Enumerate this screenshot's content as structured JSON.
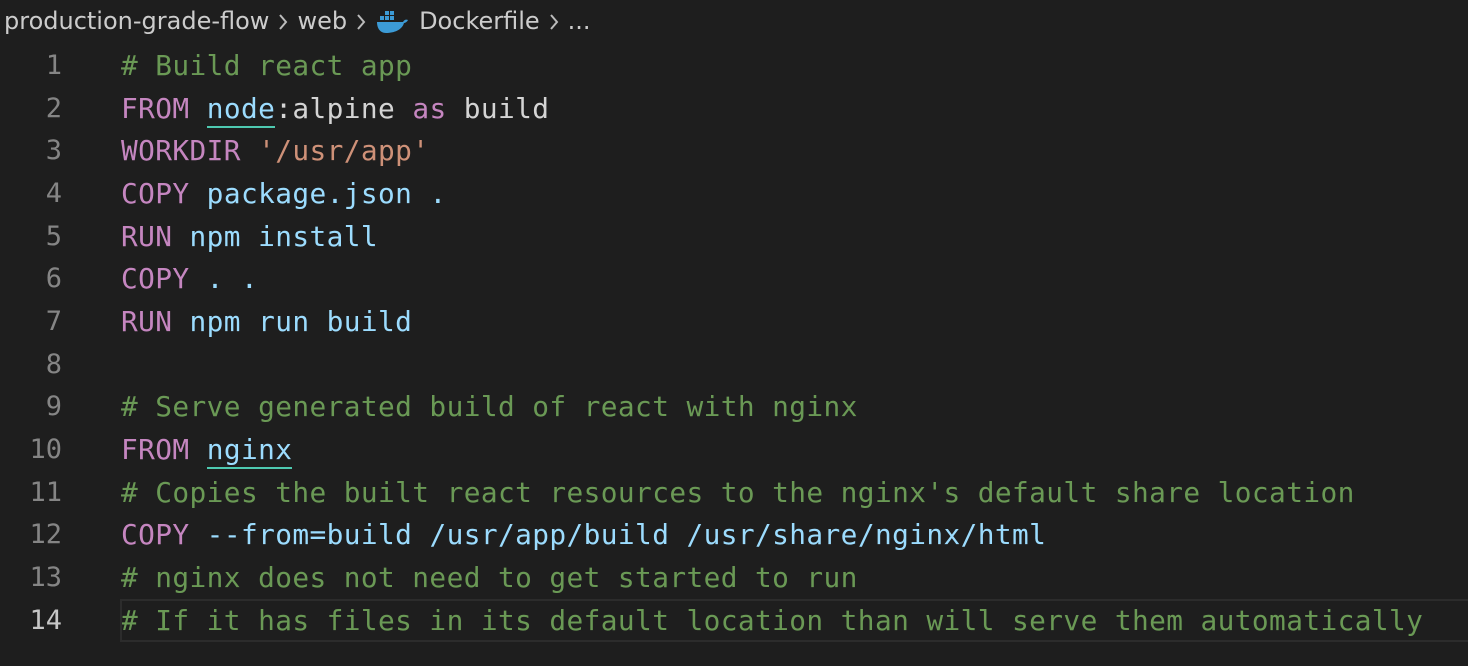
{
  "breadcrumb": {
    "items": [
      "production-grade-flow",
      "web",
      "Dockerfile",
      "..."
    ],
    "icon": "docker-icon"
  },
  "editor": {
    "language": "dockerfile",
    "colors": {
      "background": "#1e1e1e",
      "keyword": "#c586c0",
      "comment": "#6a9955",
      "string": "#ce9178",
      "identifier": "#9cdcfe",
      "link_underline": "#4ec9b0"
    },
    "current_line": 14,
    "lines": [
      {
        "n": "1",
        "parts": [
          {
            "t": "# Build react app",
            "c": "cm"
          }
        ]
      },
      {
        "n": "2",
        "parts": [
          {
            "t": "FROM",
            "c": "kw"
          },
          {
            "t": " ",
            "c": "plain"
          },
          {
            "t": "node",
            "c": "img"
          },
          {
            "t": ":alpine ",
            "c": "plain"
          },
          {
            "t": "as",
            "c": "as"
          },
          {
            "t": " build",
            "c": "plain"
          }
        ]
      },
      {
        "n": "3",
        "parts": [
          {
            "t": "WORKDIR",
            "c": "kw"
          },
          {
            "t": " ",
            "c": "plain"
          },
          {
            "t": "'/usr/app'",
            "c": "str"
          }
        ]
      },
      {
        "n": "4",
        "parts": [
          {
            "t": "COPY",
            "c": "kw"
          },
          {
            "t": " package.json .",
            "c": "id"
          }
        ]
      },
      {
        "n": "5",
        "parts": [
          {
            "t": "RUN",
            "c": "kw"
          },
          {
            "t": " npm install",
            "c": "id"
          }
        ]
      },
      {
        "n": "6",
        "parts": [
          {
            "t": "COPY",
            "c": "kw"
          },
          {
            "t": " . .",
            "c": "id"
          }
        ]
      },
      {
        "n": "7",
        "parts": [
          {
            "t": "RUN",
            "c": "kw"
          },
          {
            "t": " npm run build",
            "c": "id"
          }
        ]
      },
      {
        "n": "8",
        "parts": []
      },
      {
        "n": "9",
        "parts": [
          {
            "t": "# Serve generated build of react with nginx",
            "c": "cm"
          }
        ]
      },
      {
        "n": "10",
        "parts": [
          {
            "t": "FROM",
            "c": "kw"
          },
          {
            "t": " ",
            "c": "plain"
          },
          {
            "t": "nginx",
            "c": "img"
          }
        ]
      },
      {
        "n": "11",
        "parts": [
          {
            "t": "# Copies the built react resources to the nginx's default share location",
            "c": "cm"
          }
        ]
      },
      {
        "n": "12",
        "parts": [
          {
            "t": "COPY",
            "c": "kw"
          },
          {
            "t": " --from=build /usr/app/build /usr/share/nginx/html",
            "c": "id"
          }
        ]
      },
      {
        "n": "13",
        "parts": [
          {
            "t": "# nginx does not need to get started to run",
            "c": "cm"
          }
        ]
      },
      {
        "n": "14",
        "parts": [
          {
            "t": "# If it has files in its default location than will serve them automatically",
            "c": "cm"
          }
        ]
      }
    ]
  }
}
